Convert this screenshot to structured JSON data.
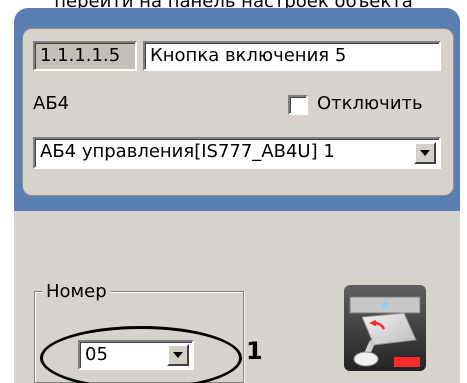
{
  "top_cut_text": "перейти на панель настроек объекта",
  "top": {
    "id_value": "1.1.1.1.5",
    "name_value": "Кнопка включения 5",
    "ab_label": "АБ4",
    "disable_label": "Отключить",
    "device_select_value": "АБ4 управления[IS777_AB4U] 1"
  },
  "bottom": {
    "group_label": "Номер",
    "number_select_value": "05",
    "callout_number": "1"
  },
  "colors": {
    "frame_blue": "#5b7fb3",
    "panel_gray": "#d7d3cc",
    "bottom_gray": "#d6d3ce"
  },
  "icons": {
    "device_icon": "switch-device-icon"
  }
}
